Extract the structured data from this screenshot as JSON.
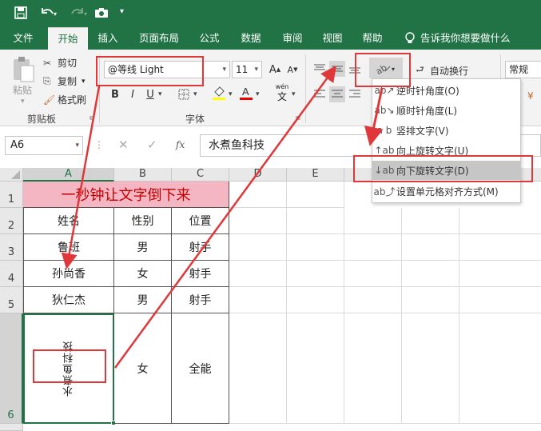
{
  "qat": {
    "save_icon": "save-icon",
    "undo_icon": "undo-icon",
    "redo_icon": "redo-icon",
    "camera_icon": "camera-icon",
    "customize": "▾"
  },
  "tabs": [
    "文件",
    "开始",
    "插入",
    "页面布局",
    "公式",
    "数据",
    "审阅",
    "视图",
    "帮助"
  ],
  "tellme": "告诉我你想要做什么",
  "clipboard": {
    "paste": "粘贴",
    "cut": "剪切",
    "copy": "复制",
    "format_painter": "格式刷",
    "group": "剪贴板"
  },
  "font": {
    "name": "@等线 Light",
    "size": "11",
    "grow": "A",
    "shrink": "A",
    "bold": "B",
    "italic": "I",
    "underline": "U",
    "group": "字体",
    "wen": "wén",
    "wen_char": "文"
  },
  "align": {
    "wrap": "自动换行"
  },
  "number": {
    "format": "常规"
  },
  "menu": [
    {
      "label": "逆时针角度(O)",
      "icon": "ab↗"
    },
    {
      "label": "顺时针角度(L)",
      "icon": "ab↘"
    },
    {
      "label": "竖排文字(V)",
      "icon": "a b"
    },
    {
      "label": "向上旋转文字(U)",
      "icon": "↑ab"
    },
    {
      "label": "向下旋转文字(D)",
      "icon": "↓ab"
    },
    {
      "label": "设置单元格对齐方式(M)",
      "icon": "ab⤴"
    }
  ],
  "namebox": "A6",
  "fx": "fx",
  "formula_value": "水煮鱼科技",
  "columns": [
    "A",
    "B",
    "C",
    "D",
    "E"
  ],
  "rows": [
    "1",
    "2",
    "3",
    "4",
    "5",
    "6"
  ],
  "title": "一秒钟让文字倒下来",
  "table": [
    [
      "姓名",
      "性别",
      "位置"
    ],
    [
      "鲁班",
      "男",
      "射手"
    ],
    [
      "孙尚香",
      "女",
      "射手"
    ],
    [
      "狄仁杰",
      "男",
      "射手"
    ],
    [
      "水煮鱼科技",
      "女",
      "全能"
    ]
  ],
  "colors": {
    "excel_green": "#217346",
    "title_fill": "#f4b6c2",
    "title_text": "#c00000",
    "annotation": "#e0383a"
  }
}
